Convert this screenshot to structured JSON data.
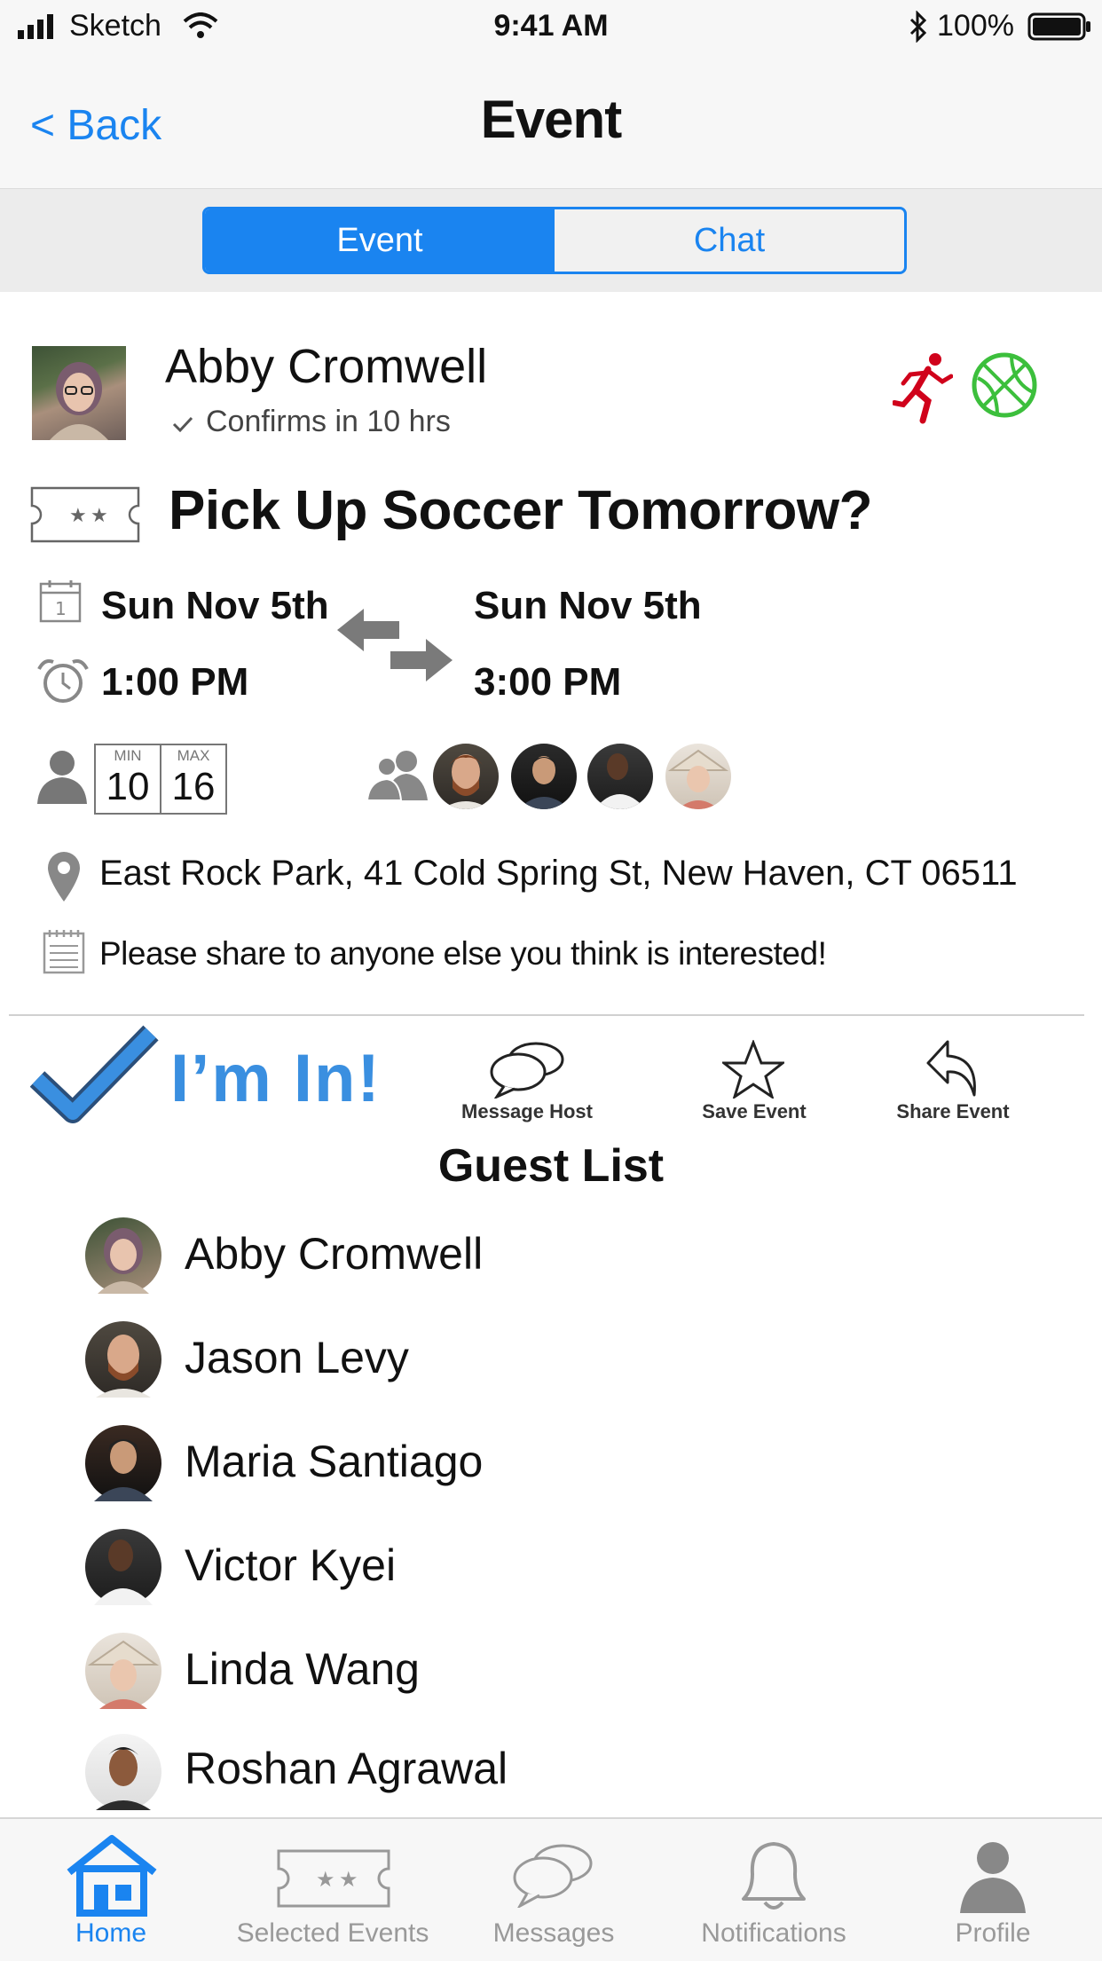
{
  "status_bar": {
    "carrier": "Sketch",
    "time": "9:41 AM",
    "battery": "100%"
  },
  "nav": {
    "back_label": "< Back",
    "title": "Event"
  },
  "segmented": {
    "event_label": "Event",
    "chat_label": "Chat",
    "selected": "Event"
  },
  "host": {
    "name": "Abby Cromwell",
    "confirm_text": "Confirms in 10 hrs"
  },
  "activity_icons": [
    "running-icon",
    "basketball-icon"
  ],
  "event": {
    "title": "Pick Up Soccer Tomorrow?",
    "start_date": "Sun Nov 5th",
    "start_time": "1:00 PM",
    "end_date": "Sun Nov 5th",
    "end_time": "3:00 PM",
    "min_label": "MIN",
    "min_value": "10",
    "max_label": "MAX",
    "max_value": "16",
    "location": "East Rock Park, 41 Cold Spring St, New Haven, CT 06511",
    "note": "Please share to anyone else you think is interested!"
  },
  "actions": {
    "im_in": "I’m In!",
    "message_host": "Message Host",
    "save_event": "Save Event",
    "share_event": "Share Event"
  },
  "guest_list": {
    "title": "Guest List",
    "guests": [
      {
        "name": "Abby Cromwell"
      },
      {
        "name": "Jason Levy"
      },
      {
        "name": "Maria Santiago"
      },
      {
        "name": "Victor Kyei"
      },
      {
        "name": "Linda Wang"
      },
      {
        "name": "Roshan Agrawal"
      }
    ]
  },
  "tab_bar": {
    "items": [
      {
        "label": "Home",
        "active": true
      },
      {
        "label": "Selected Events",
        "active": false
      },
      {
        "label": "Messages",
        "active": false
      },
      {
        "label": "Notifications",
        "active": false
      },
      {
        "label": "Profile",
        "active": false
      }
    ]
  },
  "colors": {
    "accent": "#1a84f0",
    "running_icon": "#d0021b",
    "basketball_icon": "#3cbf3c",
    "im_in": "#3a8fe0"
  }
}
